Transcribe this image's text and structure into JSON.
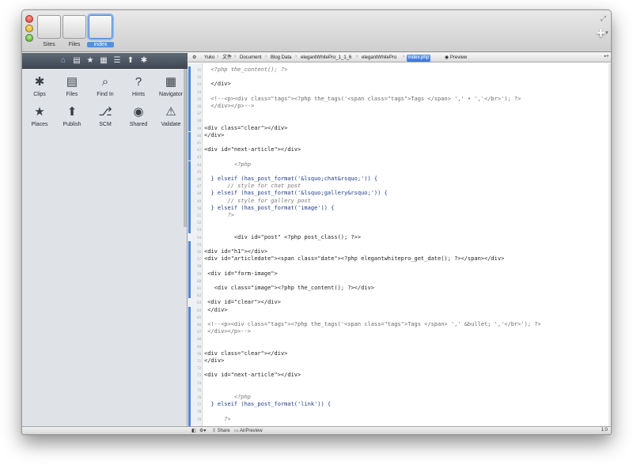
{
  "window": {
    "sites": [
      {
        "label": "Sites",
        "selected": false
      },
      {
        "label": "Files",
        "selected": false
      },
      {
        "label": "index",
        "selected": true
      }
    ]
  },
  "sidebar": {
    "nav_icons": [
      "home-icon",
      "files-icon",
      "places-icon",
      "navigator-icon",
      "hints-icon",
      "publish-icon",
      "clips-icon"
    ],
    "tools": [
      {
        "label": "Clips",
        "icon": "✱"
      },
      {
        "label": "Files",
        "icon": "▤"
      },
      {
        "label": "Find In",
        "icon": "⌕"
      },
      {
        "label": "Hints",
        "icon": "?"
      },
      {
        "label": "Navigator",
        "icon": "▦"
      },
      {
        "label": "Places",
        "icon": "★"
      },
      {
        "label": "Publish",
        "icon": "⬆"
      },
      {
        "label": "SCM",
        "icon": "⎇"
      },
      {
        "label": "Shared",
        "icon": "◉"
      },
      {
        "label": "Validate",
        "icon": "⚠"
      }
    ]
  },
  "breadcrumbs": [
    "Yuko",
    "文件",
    "Document",
    "Blog Data",
    "elegantWhitePro_1_1_6",
    "elegantWhitePro",
    "index.php",
    "Preview"
  ],
  "code_lines": [
    {
      "n": "31",
      "t": "  <?php the_content(); ?>"
    },
    {
      "n": "32",
      "t": ""
    },
    {
      "n": "33",
      "t": "  </div>"
    },
    {
      "n": "34",
      "t": ""
    },
    {
      "n": "35",
      "t": "  <!--<p><div class=\"tags\"><?php the_tags('<span class=\"tags\">Tags </span> ',' • ','</br>'); ?>"
    },
    {
      "n": "36",
      "t": "  </div></p>-->"
    },
    {
      "n": "37",
      "t": ""
    },
    {
      "n": "38",
      "t": ""
    },
    {
      "n": "39",
      "t": "<div class=\"clear\"></div>"
    },
    {
      "n": "40",
      "t": "</div>"
    },
    {
      "n": "41",
      "t": ""
    },
    {
      "n": "42",
      "t": "<div id=\"next-article\"></div>"
    },
    {
      "n": "43",
      "t": ""
    },
    {
      "n": "44",
      "t": "         <?php"
    },
    {
      "n": "45",
      "t": ""
    },
    {
      "n": "46",
      "t": "  } elseif (has_post_format('&lsquo;chat&rsquo;')) {"
    },
    {
      "n": "47",
      "t": "       // style for chat post"
    },
    {
      "n": "48",
      "t": "  } elseif (has_post_format('&lsquo;gallery&rsquo;')) {"
    },
    {
      "n": "49",
      "t": "       // style for gallery post"
    },
    {
      "n": "50",
      "t": "  } elseif (has_post_format('image')) {"
    },
    {
      "n": "51",
      "t": "       ?>"
    },
    {
      "n": "52",
      "t": ""
    },
    {
      "n": "53",
      "t": ""
    },
    {
      "n": "54",
      "t": "         <div id=\"post\" <?php post_class(); ?>>"
    },
    {
      "n": "55",
      "t": ""
    },
    {
      "n": "56",
      "t": "<div id=\"h1\"></div>"
    },
    {
      "n": "57",
      "t": "<div id=\"articledate\"><span class=\"date\"><?php elegantwhitepro_get_date(); ?></span></div>"
    },
    {
      "n": "58",
      "t": ""
    },
    {
      "n": "59",
      "t": " <div id=\"form-image\">"
    },
    {
      "n": "60",
      "t": ""
    },
    {
      "n": "61",
      "t": "   <div class=\"image\"><?php the_content(); ?></div>"
    },
    {
      "n": "62",
      "t": ""
    },
    {
      "n": "63",
      "t": " <div id=\"clear\"></div>"
    },
    {
      "n": "64",
      "t": " </div>"
    },
    {
      "n": "65",
      "t": ""
    },
    {
      "n": "66",
      "t": " <!--<p><div class=\"tags\"><?php the_tags('<span class=\"tags\">Tags </span> ',' &bullet; ','</br>'); ?>"
    },
    {
      "n": "67",
      "t": " </div></p>-->"
    },
    {
      "n": "68",
      "t": ""
    },
    {
      "n": "69",
      "t": ""
    },
    {
      "n": "70",
      "t": "<div class=\"clear\"></div>"
    },
    {
      "n": "71",
      "t": "</div>"
    },
    {
      "n": "72",
      "t": ""
    },
    {
      "n": "73",
      "t": "<div id=\"next-article\"></div>"
    },
    {
      "n": "74",
      "t": ""
    },
    {
      "n": "75",
      "t": ""
    },
    {
      "n": "76",
      "t": "         <?php"
    },
    {
      "n": "77",
      "t": "  } elseif (has_post_format('link')) {"
    },
    {
      "n": "78",
      "t": ""
    },
    {
      "n": "79",
      "t": "      ?>"
    }
  ],
  "statusbar": {
    "share_label": "Share",
    "airpreview_label": "AirPreview",
    "position": "1:0"
  },
  "colors": {
    "accent": "#3b73d6",
    "sidebar_bar": "#4b5561"
  }
}
